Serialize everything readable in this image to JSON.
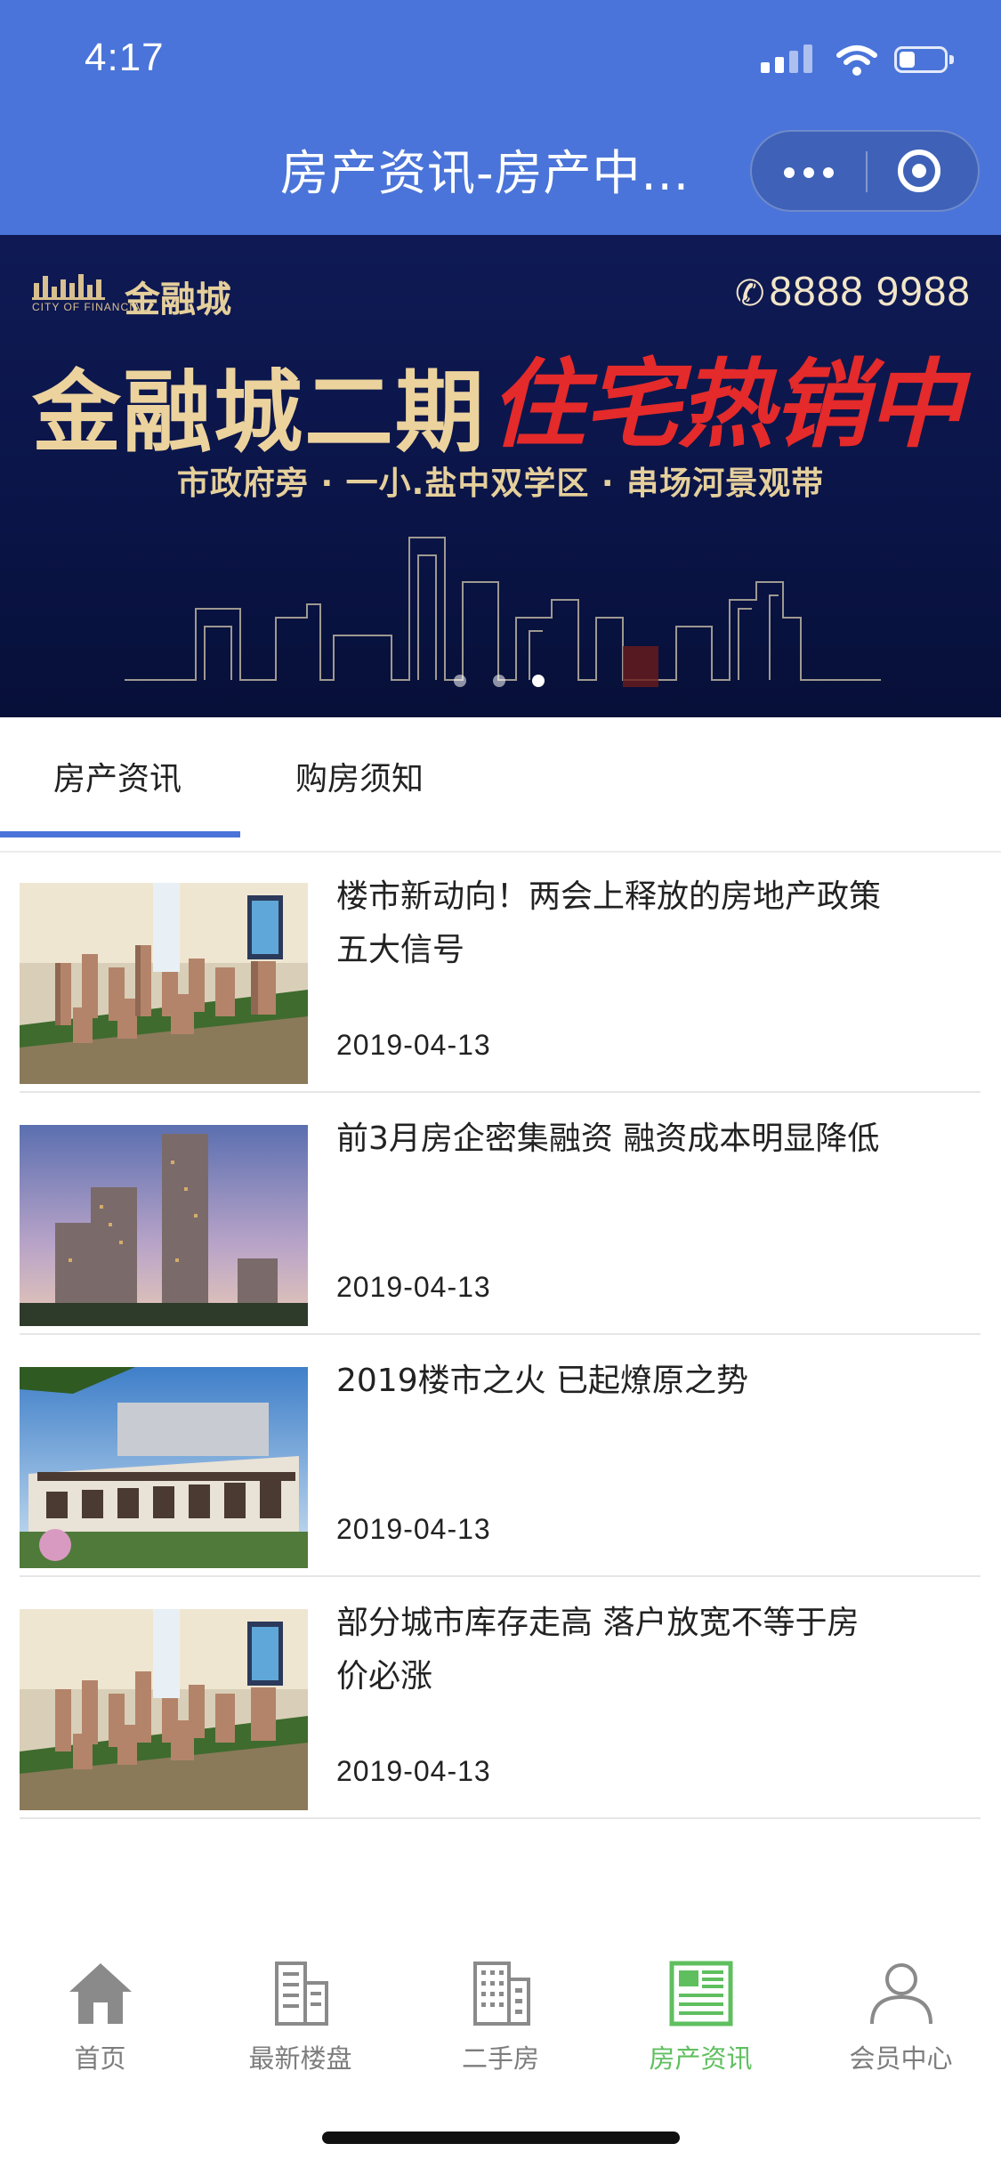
{
  "status_bar": {
    "time": "4:17",
    "battery_level": 0.35
  },
  "nav": {
    "title": "房产资讯-房产中..."
  },
  "banner": {
    "brand_name": "金融城",
    "brand_sub": "CITY OF FINANCIAL",
    "phone": "8888 9988",
    "headline_gold": "金融城二期",
    "headline_red": "住宅热销中",
    "tagline": "市政府旁 · 一小.盐中双学区 · 串场河景观带",
    "slides": 3,
    "active_slide": 2
  },
  "tabs": [
    {
      "label": "房产资讯",
      "active": true
    },
    {
      "label": "购房须知",
      "active": false
    }
  ],
  "news": [
    {
      "title": "楼市新动向！两会上释放的房地产政策五大信号",
      "date": "2019-04-13",
      "thumb": "sand-table-model"
    },
    {
      "title": "前3月房企密集融资 融资成本明显降低",
      "date": "2019-04-13",
      "thumb": "high-rise-dusk"
    },
    {
      "title": "2019楼市之火 已起燎原之势",
      "date": "2019-04-13",
      "thumb": "villa-rendering"
    },
    {
      "title": "部分城市库存走高 落户放宽不等于房价必涨",
      "date": "2019-04-13",
      "thumb": "sand-table-model"
    }
  ],
  "tabbar": [
    {
      "label": "首页",
      "icon": "home-icon",
      "active": false
    },
    {
      "label": "最新楼盘",
      "icon": "building-icon",
      "active": false
    },
    {
      "label": "二手房",
      "icon": "apartment-icon",
      "active": false
    },
    {
      "label": "房产资讯",
      "icon": "newspaper-icon",
      "active": true
    },
    {
      "label": "会员中心",
      "icon": "user-icon",
      "active": false
    }
  ],
  "colors": {
    "primary": "#4a74d9",
    "active_tab": "#5fbf5f",
    "banner_bg": "#0f1a55",
    "gold": "#ecd39d",
    "red": "#e42a2a"
  }
}
